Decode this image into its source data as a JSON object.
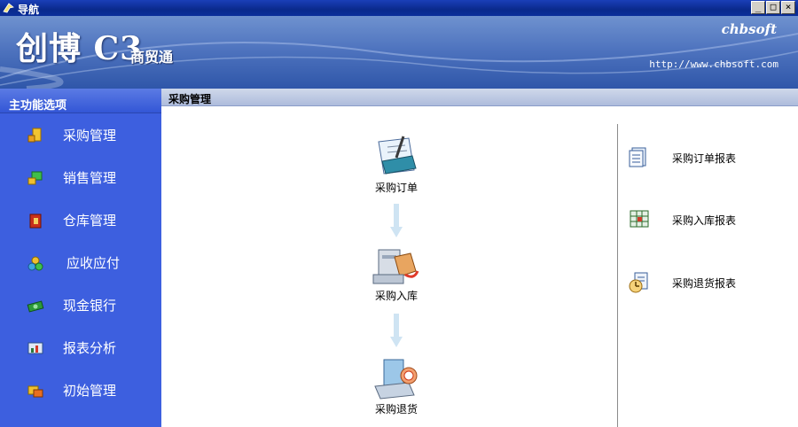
{
  "window": {
    "title": "导航"
  },
  "window_buttons": {
    "minimize": "_",
    "maximize": "□",
    "close": "×"
  },
  "banner": {
    "logo": "创博 C3",
    "logo_sub": "商贸通",
    "brand": "chbsoft",
    "url": "http://www.chbsoft.com"
  },
  "sidebar": {
    "header": "主功能选项",
    "items": [
      {
        "label": "采购管理",
        "icon": "purchase-icon"
      },
      {
        "label": "销售管理",
        "icon": "sales-icon"
      },
      {
        "label": "仓库管理",
        "icon": "warehouse-icon"
      },
      {
        "label": "应收应付",
        "icon": "receivable-icon"
      },
      {
        "label": "现金银行",
        "icon": "cash-icon"
      },
      {
        "label": "报表分析",
        "icon": "report-analysis-icon"
      },
      {
        "label": "初始管理",
        "icon": "init-icon"
      }
    ]
  },
  "main": {
    "header": "采购管理",
    "flow": [
      {
        "label": "采购订单",
        "icon": "purchase-order-icon"
      },
      {
        "label": "采购入库",
        "icon": "purchase-stockin-icon"
      },
      {
        "label": "采购退货",
        "icon": "purchase-return-icon"
      }
    ],
    "reports": [
      {
        "label": "采购订单报表",
        "icon": "order-report-icon"
      },
      {
        "label": "采购入库报表",
        "icon": "stockin-report-icon"
      },
      {
        "label": "采购退货报表",
        "icon": "return-report-icon"
      }
    ]
  }
}
